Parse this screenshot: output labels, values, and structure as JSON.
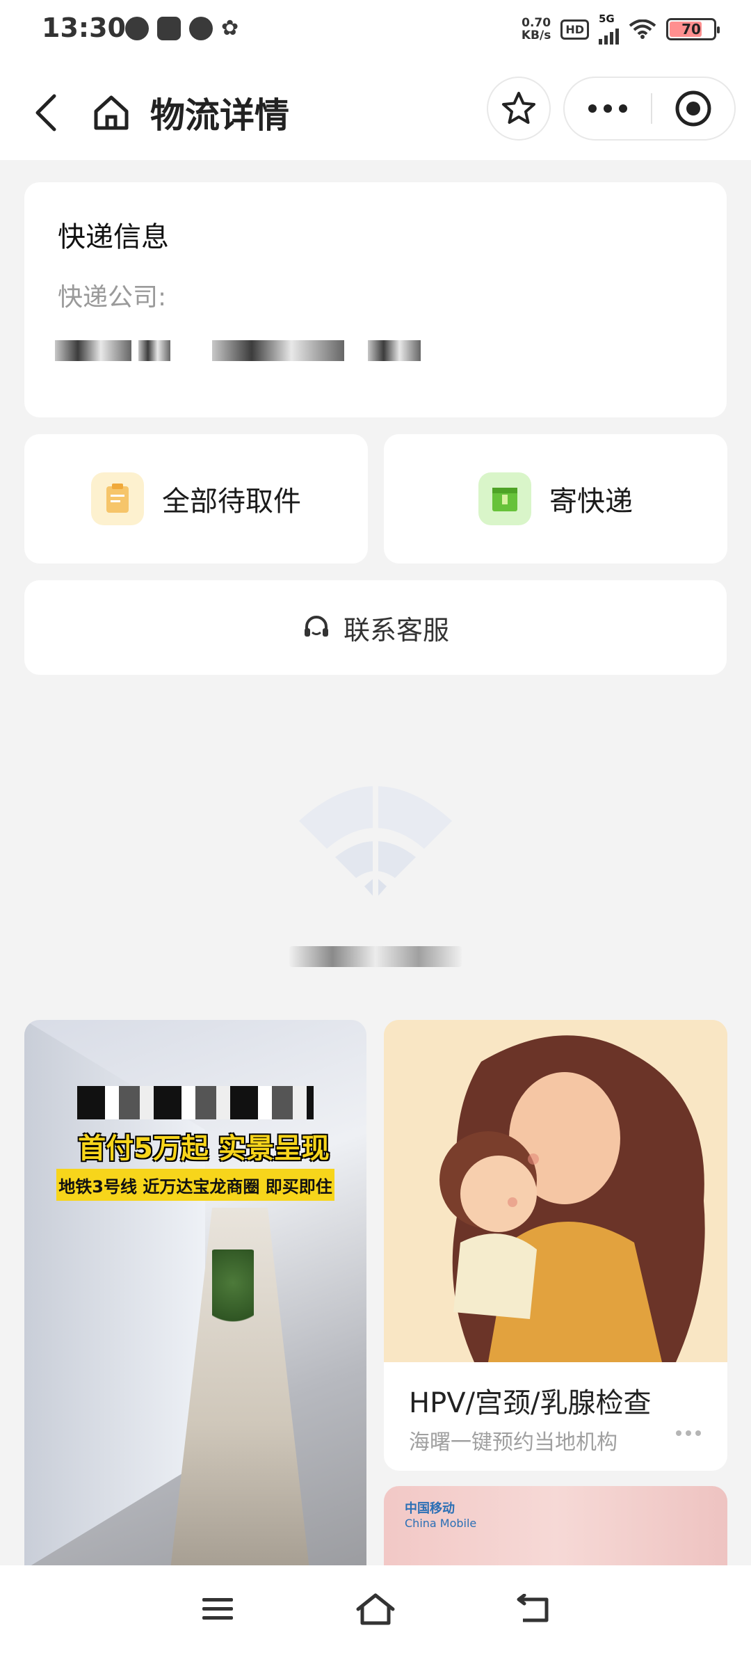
{
  "status_bar": {
    "time": "13:30",
    "net_speed_value": "0.70",
    "net_speed_unit": "KB/s",
    "hd": "HD",
    "network": "5G",
    "battery": "70"
  },
  "nav": {
    "title": "物流详情"
  },
  "express": {
    "title": "快递信息",
    "company_label": "快递公司:"
  },
  "actions": {
    "pickup_label": "全部待取件",
    "send_label": "寄快递"
  },
  "service": {
    "label": "联系客服"
  },
  "feed": {
    "ad_headline": "首付5万起 实景呈现",
    "ad_sub": "地铁3号线 近万达宝龙商圈 即买即住",
    "card_title": "HPV/宫颈/乳腺检查",
    "card_sub": "海曙一键预约当地机构",
    "cm_logo_cn": "中国移动",
    "cm_logo_en": "China Mobile"
  },
  "colors": {
    "accent_yellow": "#f7d51b",
    "pickup_icon_bg": "#fdf1cf",
    "send_icon_bg": "#d9f5c9",
    "page_bg": "#f3f3f3"
  }
}
